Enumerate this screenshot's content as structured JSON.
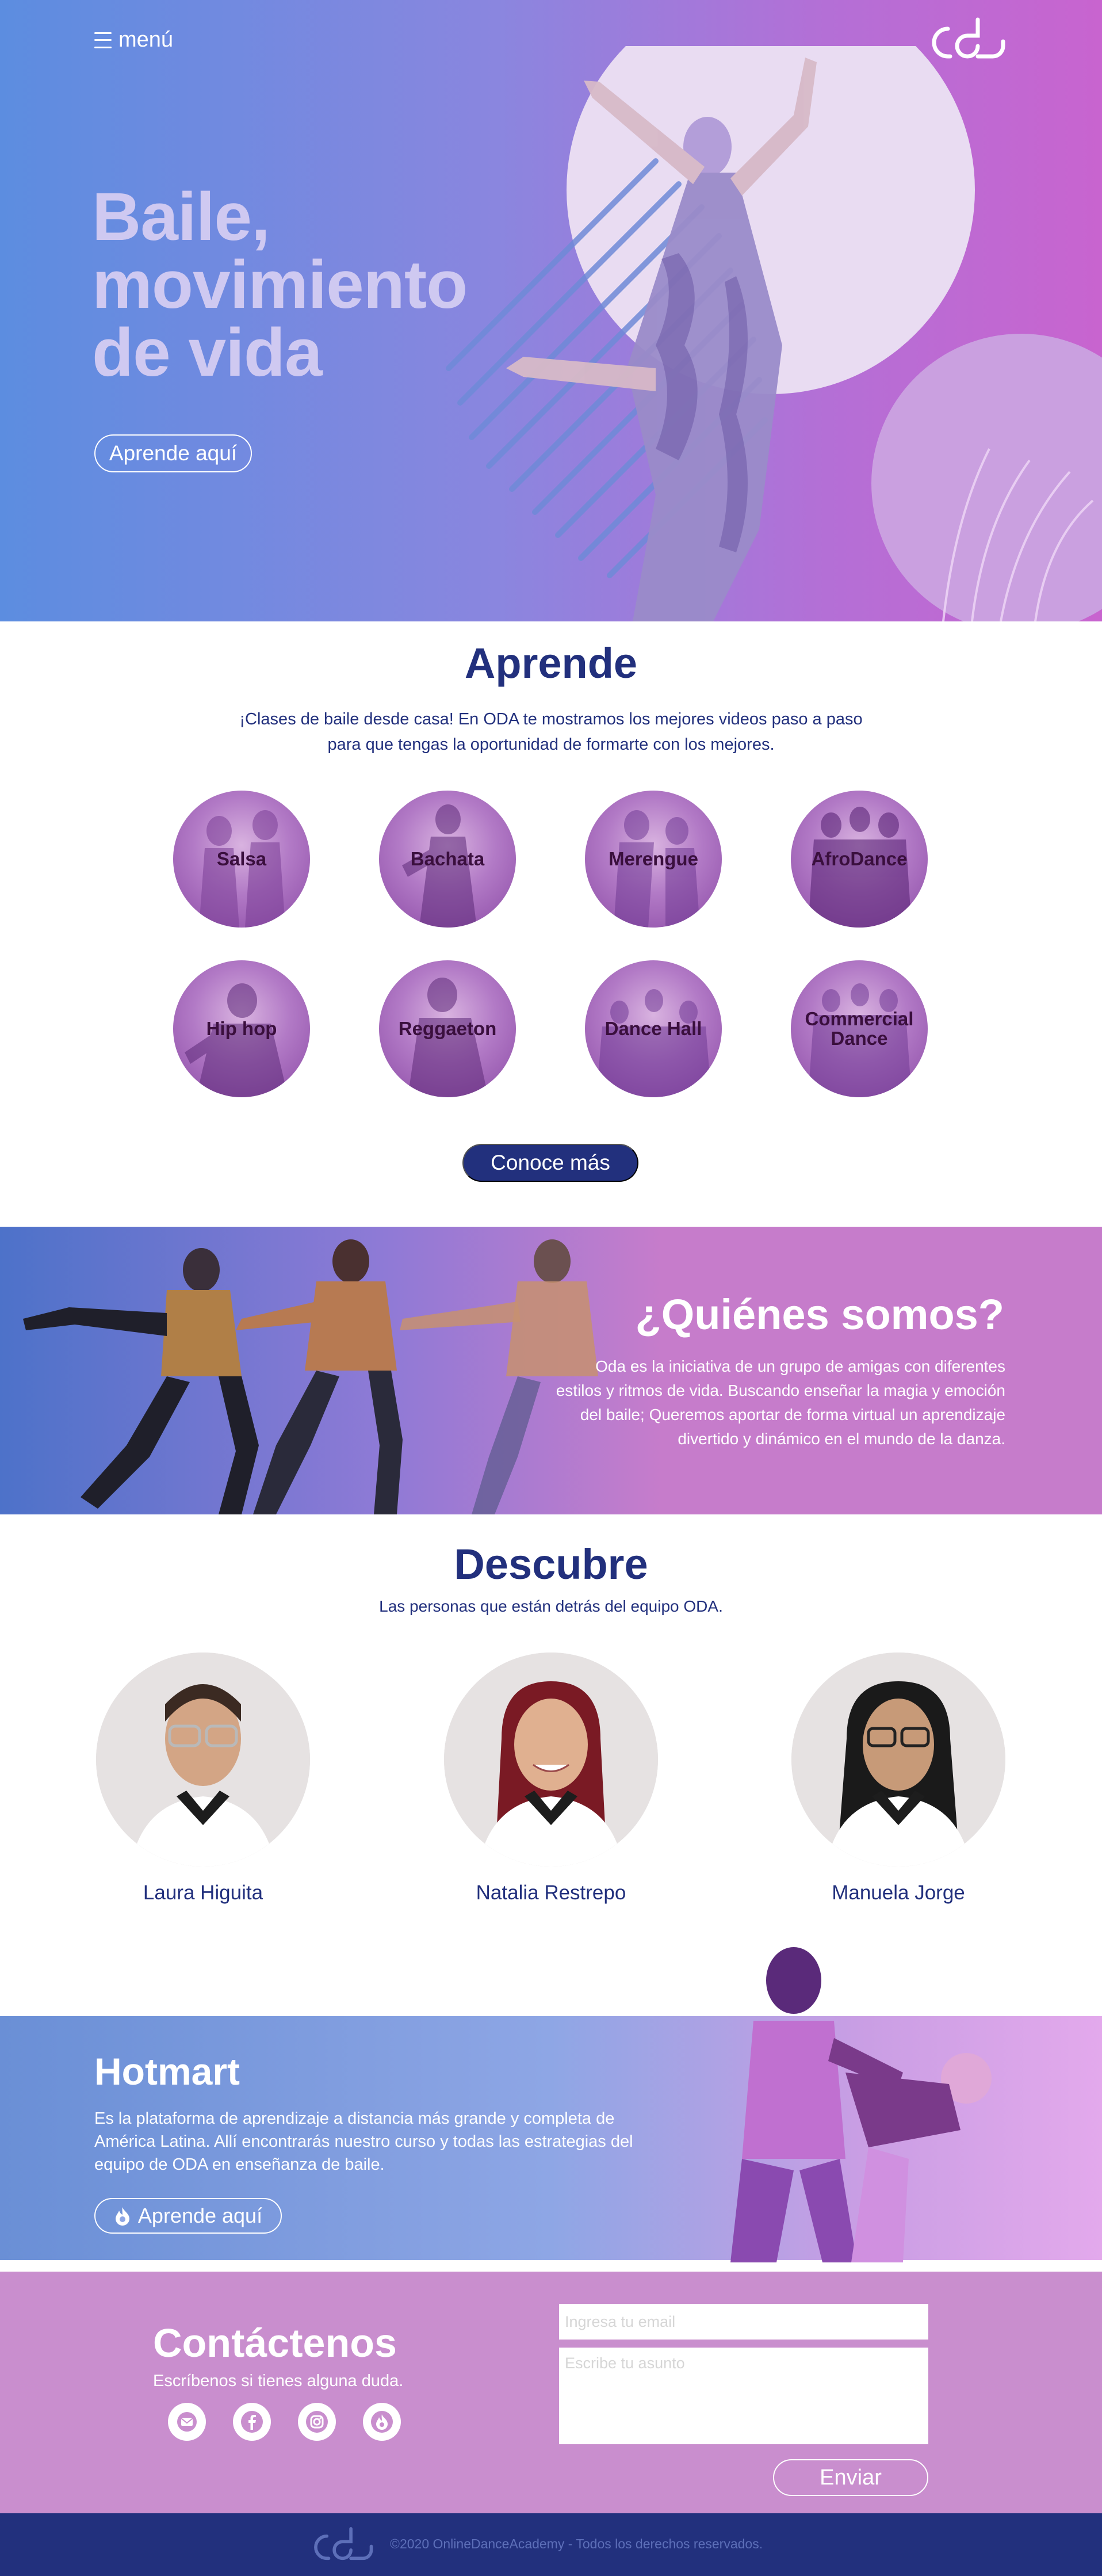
{
  "colors": {
    "navy": "#22307d",
    "hero_from": "#5c8de0",
    "hero_to": "#c864cf",
    "contact_bg": "#c98ece",
    "footer_bg": "#22307d"
  },
  "header": {
    "menu_icon": "hamburger-icon",
    "menu_label": "menú",
    "logo_icon": "oda-logo-icon"
  },
  "hero": {
    "title_line1": "Baile,",
    "title_line2": "movimiento",
    "title_line3": "de vida",
    "cta": "Aprende aquí"
  },
  "aprende": {
    "title": "Aprende",
    "description": "¡Clases de baile desde casa! En ODA te mostramos los mejores videos paso a paso para que tengas la oportunidad de formarte con los mejores.",
    "styles": [
      "Salsa",
      "Bachata",
      "Merengue",
      "AfroDance",
      "Hip hop",
      "Reggaeton",
      "Dance Hall",
      "Commercial Dance"
    ],
    "cta": "Conoce más"
  },
  "quienes": {
    "title": "¿Quiénes somos?",
    "text": "Oda es la iniciativa de un grupo de amigas con diferentes estilos y ritmos de vida. Buscando enseñar la magia y emoción del baile; Queremos aportar de forma virtual un aprendizaje divertido y dinámico en el mundo de la danza."
  },
  "descubre": {
    "title": "Descubre",
    "subtitle": "Las personas que están detrás del equipo ODA.",
    "members": [
      "Laura Higuita",
      "Natalia Restrepo",
      "Manuela Jorge"
    ]
  },
  "hotmart": {
    "title": "Hotmart",
    "text": "Es la plataforma de aprendizaje a distancia más grande y completa de América Latina. Allí encontrarás nuestro curso y todas las estrategias del equipo de ODA en enseñanza de baile.",
    "cta": "Aprende aquí",
    "cta_icon": "hotmart-flame-icon"
  },
  "contact": {
    "title": "Contáctenos",
    "subtitle": "Escríbenos si tienes alguna duda.",
    "email_placeholder": "Ingresa tu email",
    "subject_placeholder": "Escribe tu asunto",
    "submit": "Enviar",
    "social_icons": [
      "mail-icon",
      "facebook-icon",
      "instagram-icon",
      "hotmart-icon"
    ]
  },
  "footer": {
    "copyright": "©2020 OnlineDanceAcademy - Todos los derechos reservados."
  }
}
